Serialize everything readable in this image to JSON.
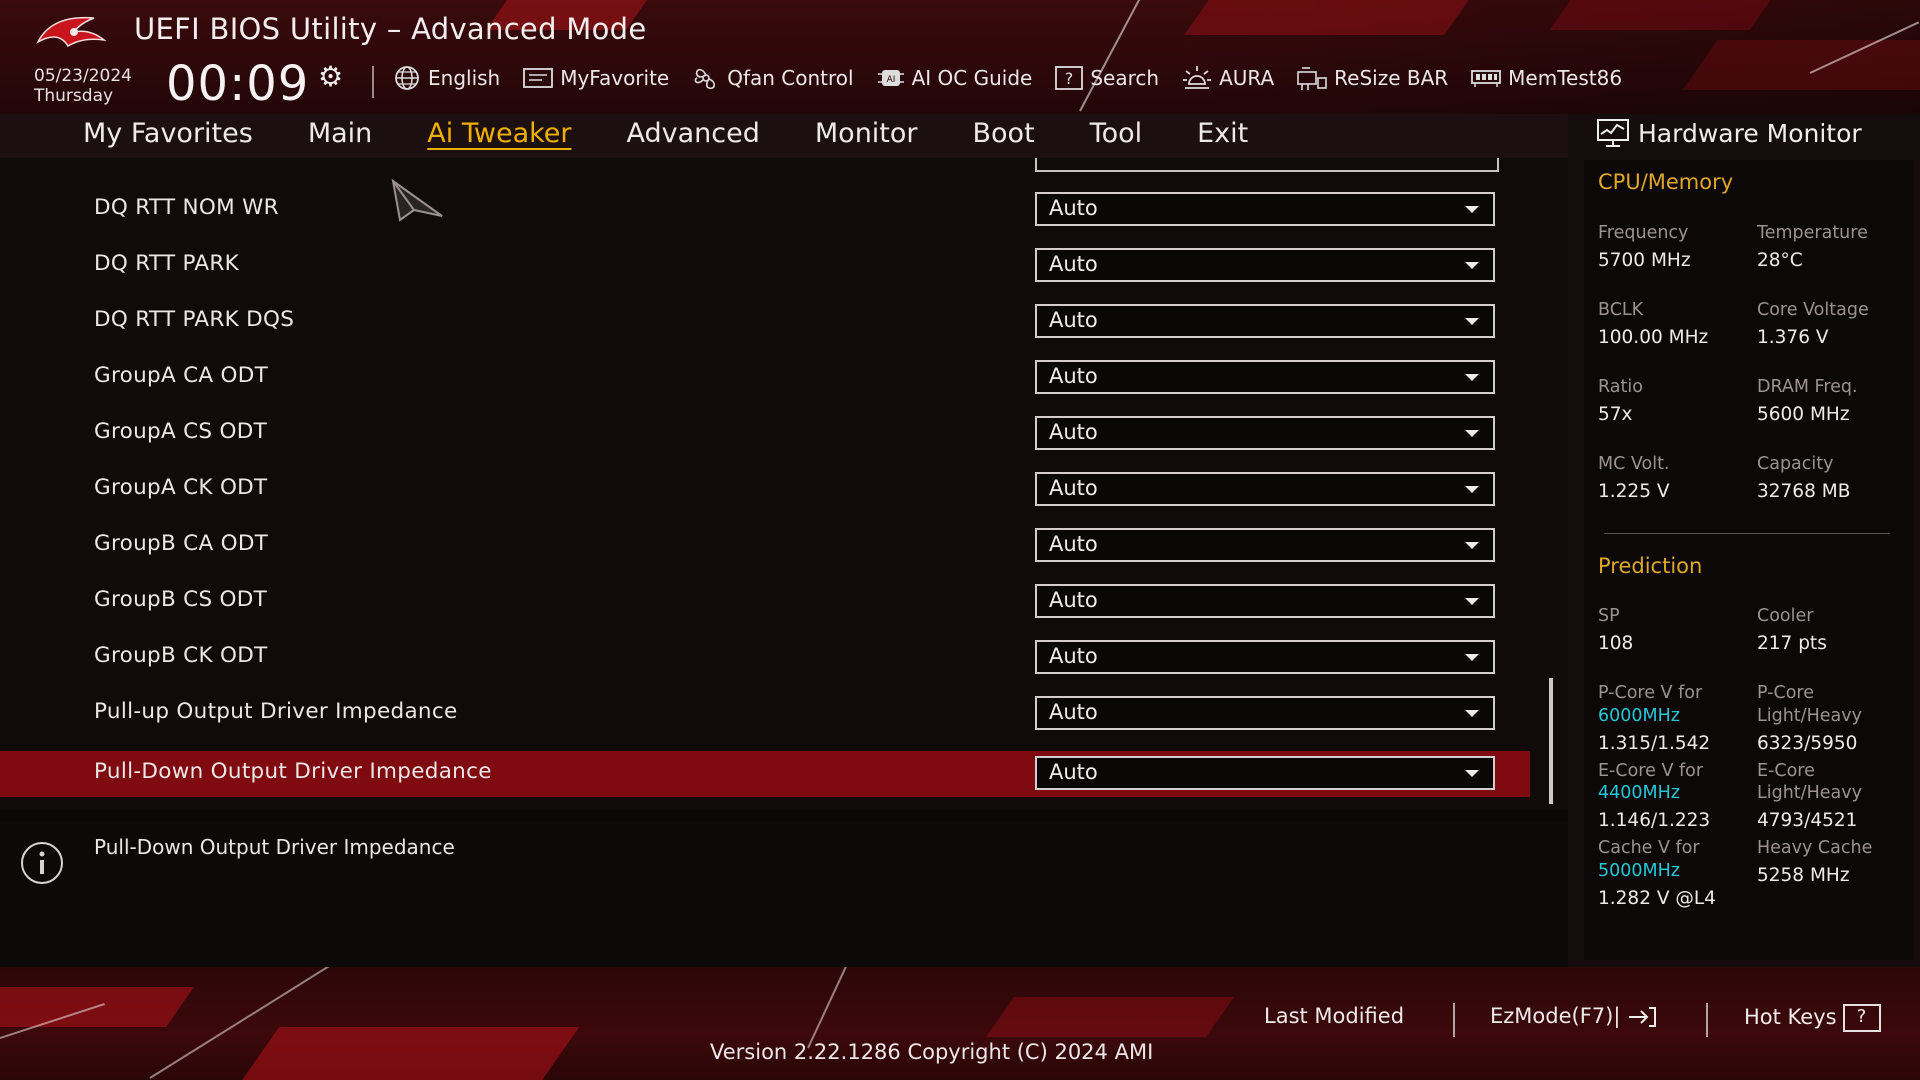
{
  "header": {
    "title": "UEFI BIOS Utility – Advanced Mode",
    "date": "05/23/2024",
    "day": "Thursday",
    "time": "00:09"
  },
  "toolbar": [
    {
      "label": "English",
      "icon": "globe-icon"
    },
    {
      "label": "MyFavorite",
      "icon": "favorite-list-icon"
    },
    {
      "label": "Qfan Control",
      "icon": "fan-icon"
    },
    {
      "label": "AI OC Guide",
      "icon": "ai-chip-icon"
    },
    {
      "label": "Search",
      "icon": "question-box-icon"
    },
    {
      "label": "AURA",
      "icon": "aura-light-icon"
    },
    {
      "label": "ReSize BAR",
      "icon": "resize-bar-icon"
    },
    {
      "label": "MemTest86",
      "icon": "memory-icon"
    }
  ],
  "tabs": [
    "My Favorites",
    "Main",
    "Ai Tweaker",
    "Advanced",
    "Monitor",
    "Boot",
    "Tool",
    "Exit"
  ],
  "active_tab": "Ai Tweaker",
  "settings": [
    {
      "label": "DQ RTT NOM WR",
      "value": "Auto"
    },
    {
      "label": "DQ RTT PARK",
      "value": "Auto"
    },
    {
      "label": "DQ RTT PARK DQS",
      "value": "Auto"
    },
    {
      "label": "GroupA CA ODT",
      "value": "Auto"
    },
    {
      "label": "GroupA CS ODT",
      "value": "Auto"
    },
    {
      "label": "GroupA CK ODT",
      "value": "Auto"
    },
    {
      "label": "GroupB CA ODT",
      "value": "Auto"
    },
    {
      "label": "GroupB CS ODT",
      "value": "Auto"
    },
    {
      "label": "GroupB CK ODT",
      "value": "Auto"
    },
    {
      "label": "Pull-up Output Driver Impedance",
      "value": "Auto"
    },
    {
      "label": "Pull-Down Output Driver Impedance",
      "value": "Auto",
      "selected": true
    }
  ],
  "help_text": "Pull-Down Output Driver Impedance",
  "hardware_monitor": {
    "title": "Hardware Monitor",
    "cpu_memory": {
      "heading": "CPU/Memory",
      "frequency_label": "Frequency",
      "frequency": "5700 MHz",
      "temperature_label": "Temperature",
      "temperature": "28°C",
      "bclk_label": "BCLK",
      "bclk": "100.00 MHz",
      "core_voltage_label": "Core Voltage",
      "core_voltage": "1.376 V",
      "ratio_label": "Ratio",
      "ratio": "57x",
      "dram_freq_label": "DRAM Freq.",
      "dram_freq": "5600 MHz",
      "mc_volt_label": "MC Volt.",
      "mc_volt": "1.225 V",
      "capacity_label": "Capacity",
      "capacity": "32768 MB"
    },
    "prediction": {
      "heading": "Prediction",
      "sp_label": "SP",
      "sp": "108",
      "cooler_label": "Cooler",
      "cooler": "217 pts",
      "pcore_v_label": "P-Core V for",
      "pcore_v_freq": "6000MHz",
      "pcore_v": "1.315/1.542",
      "pcore_lh_label_1": "P-Core",
      "pcore_lh_label_2": "Light/Heavy",
      "pcore_lh": "6323/5950",
      "ecore_v_label": "E-Core V for",
      "ecore_v_freq": "4400MHz",
      "ecore_v": "1.146/1.223",
      "ecore_lh_label_1": "E-Core",
      "ecore_lh_label_2": "Light/Heavy",
      "ecore_lh": "4793/4521",
      "cache_v_label": "Cache V for",
      "cache_v_freq": "5000MHz",
      "cache_v": "1.282 V @L4",
      "heavy_cache_label": "Heavy Cache",
      "heavy_cache": "5258 MHz"
    }
  },
  "footer": {
    "last_modified": "Last Modified",
    "ezmode": "EzMode(F7)|",
    "hotkeys": "Hot Keys",
    "hotkeys_key": "?",
    "version": "Version 2.22.1286 Copyright (C) 2024 AMI"
  },
  "colors": {
    "accent_active_tab": "#f0b000",
    "section_heading": "#e0a72a",
    "prediction_freq": "#25c7d8",
    "selected_row": "#7f0a10"
  }
}
